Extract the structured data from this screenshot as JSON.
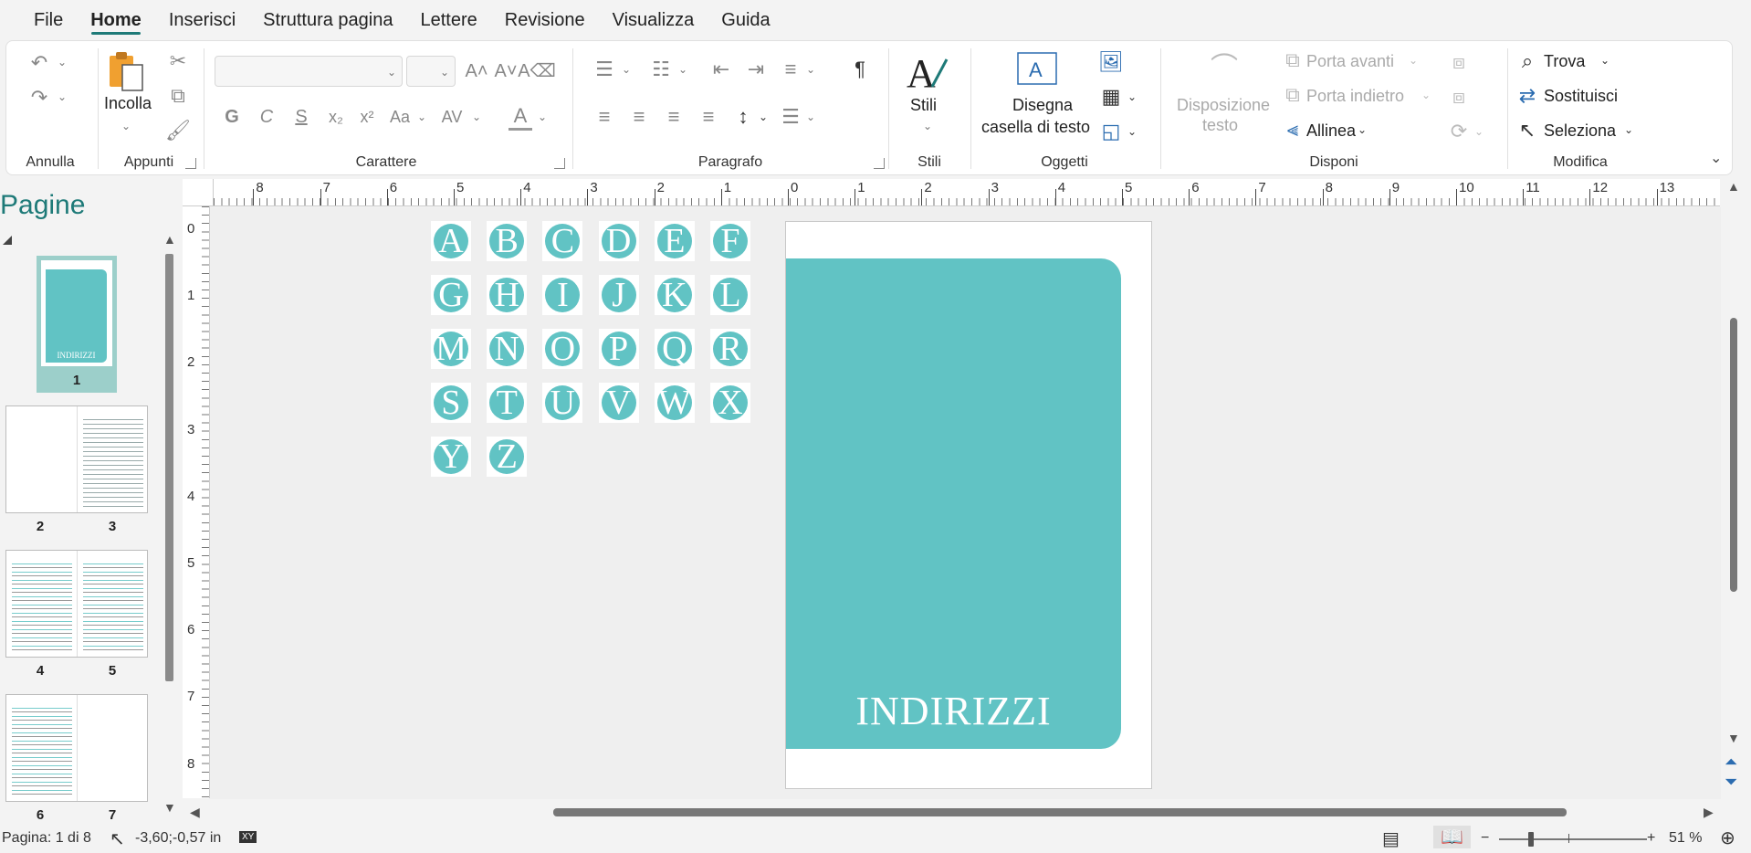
{
  "menu": [
    "File",
    "Home",
    "Inserisci",
    "Struttura pagina",
    "Lettere",
    "Revisione",
    "Visualizza",
    "Guida"
  ],
  "active_menu": "Home",
  "ribbon": {
    "groups": {
      "annulla": "Annulla",
      "appunti": "Appunti",
      "carattere": "Carattere",
      "paragrafo": "Paragrafo",
      "stili": "Stili",
      "oggetti": "Oggetti",
      "disponi": "Disponi",
      "modifica": "Modifica"
    },
    "paste_label": "Incolla",
    "stili_label": "Stili",
    "draw_textbox_line1": "Disegna",
    "draw_textbox_line2": "casella di testo",
    "text_wrap_line1": "Disposizione",
    "text_wrap_line2": "testo",
    "bring_forward": "Porta avanti",
    "send_backward": "Porta indietro",
    "align": "Allinea",
    "find": "Trova",
    "replace": "Sostituisci",
    "select": "Seleziona",
    "font_buttons": [
      "G",
      "C",
      "S",
      "x₂",
      "x²",
      "Aa"
    ]
  },
  "pages_panel": {
    "title": "Pagine",
    "thumb_numbers": [
      "1",
      "2",
      "3",
      "4",
      "5",
      "6",
      "7"
    ],
    "cover_thumb_text": "INDIRIZZI"
  },
  "ruler": {
    "horizontal": [
      "8",
      "7",
      "6",
      "5",
      "4",
      "3",
      "2",
      "1",
      "0",
      "1",
      "2",
      "3",
      "4",
      "5",
      "6",
      "7",
      "8",
      "9",
      "10",
      "11",
      "12",
      "13"
    ],
    "vertical": [
      "0",
      "1",
      "2",
      "3",
      "4",
      "5",
      "6",
      "7",
      "8"
    ]
  },
  "letters": [
    "A",
    "B",
    "C",
    "D",
    "E",
    "F",
    "G",
    "H",
    "I",
    "J",
    "K",
    "L",
    "M",
    "N",
    "O",
    "P",
    "Q",
    "R",
    "S",
    "T",
    "U",
    "V",
    "W",
    "X",
    "Y",
    "Z"
  ],
  "cover": {
    "title": "INDIRIZZI",
    "accent": "#61c3c4"
  },
  "status": {
    "page": "Pagina: 1 di 8",
    "coords": "-3,60;-0,57 in",
    "zoom": "51 %",
    "zoom_percent": 51
  },
  "colors": {
    "brand": "#1e7a78",
    "teal": "#61c3c4"
  }
}
